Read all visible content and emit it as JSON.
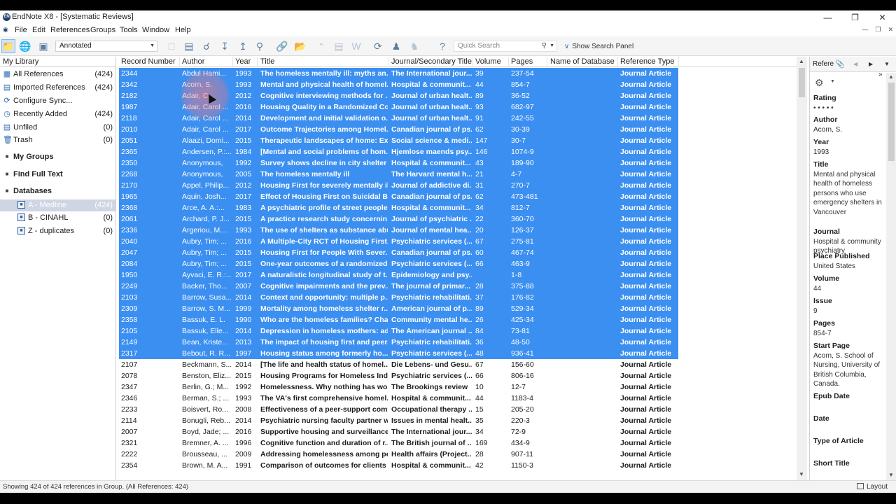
{
  "window": {
    "title": "EndNote X8 - [Systematic Reviews]",
    "app_icon_text": "EN"
  },
  "window_controls": [
    "minimize",
    "restore",
    "close"
  ],
  "menu": [
    "File",
    "Edit",
    "References",
    "Groups",
    "Tools",
    "Window",
    "Help"
  ],
  "toolbar": {
    "style": "Annotated",
    "quick_search_placeholder": "Quick Search",
    "show_search_panel": "Show Search Panel"
  },
  "library": {
    "header": "My Library",
    "groups": [
      {
        "label": "All References",
        "count": "(424)",
        "icon": "library-icon"
      },
      {
        "label": "Imported References",
        "count": "(424)",
        "icon": "import-icon"
      },
      {
        "label": "Configure Sync...",
        "count": "",
        "icon": "sync-icon"
      },
      {
        "label": "Recently Added",
        "count": "(424)",
        "icon": "clock-icon"
      },
      {
        "label": "Unfiled",
        "count": "(0)",
        "icon": "unfiled-icon"
      },
      {
        "label": "Trash",
        "count": "(0)",
        "icon": "trash-icon"
      }
    ],
    "sections": [
      "My Groups",
      "Find Full Text",
      "Databases"
    ],
    "databases": [
      {
        "label": "A - Medline",
        "count": "(424)"
      },
      {
        "label": "B - CINAHL",
        "count": "(0)"
      },
      {
        "label": "Z - duplicates",
        "count": "(0)"
      }
    ]
  },
  "columns": [
    "Record Number",
    "Author",
    "Year",
    "Title",
    "Journal/Secondary Title",
    "Volume",
    "Pages",
    "Name of Database",
    "Reference Type"
  ],
  "references": [
    {
      "rec": "2344",
      "author": "Abdul Hami...",
      "year": "1993",
      "title": "The homeless mentally ill: myths an...",
      "journal": "The International jour...",
      "vol": "39",
      "pages": "237-54",
      "db": "",
      "type": "Journal Article",
      "sel": true
    },
    {
      "rec": "2342",
      "author": "Acorn, S.",
      "year": "1993",
      "title": "Mental and physical health of homel...",
      "journal": "Hospital & communit...",
      "vol": "44",
      "pages": "854-7",
      "db": "",
      "type": "Journal Article",
      "sel": true
    },
    {
      "rec": "2182",
      "author": "Adair, C...",
      "year": "2012",
      "title": "Cognitive interviewing methods for ...",
      "journal": "Journal of urban healt...",
      "vol": "89",
      "pages": "36-52",
      "db": "",
      "type": "Journal Article",
      "sel": true
    },
    {
      "rec": "1987",
      "author": "Adair, Carol ...",
      "year": "2016",
      "title": "Housing Quality in a Randomized Co...",
      "journal": "Journal of urban healt...",
      "vol": "93",
      "pages": "682-97",
      "db": "",
      "type": "Journal Article",
      "sel": true
    },
    {
      "rec": "2118",
      "author": "Adair, Carol ...",
      "year": "2014",
      "title": "Development and initial validation o...",
      "journal": "Journal of urban healt...",
      "vol": "91",
      "pages": "242-55",
      "db": "",
      "type": "Journal Article",
      "sel": true
    },
    {
      "rec": "2010",
      "author": "Adair, Carol ...",
      "year": "2017",
      "title": "Outcome Trajectories among Homel...",
      "journal": "Canadian journal of ps...",
      "vol": "62",
      "pages": "30-39",
      "db": "",
      "type": "Journal Article",
      "sel": true
    },
    {
      "rec": "2051",
      "author": "Alaazi, Domi...",
      "year": "2015",
      "title": "Therapeutic landscapes of home: Ex...",
      "journal": "Social science & medi...",
      "vol": "147",
      "pages": "30-7",
      "db": "",
      "type": "Journal Article",
      "sel": true
    },
    {
      "rec": "2365",
      "author": "Andersen, P.:...",
      "year": "1984",
      "title": "[Mental and social problems of hom...",
      "journal": "Hjemlose maends psy...",
      "vol": "146",
      "pages": "1074-9",
      "db": "",
      "type": "Journal Article",
      "sel": true
    },
    {
      "rec": "2350",
      "author": "Anonymous,",
      "year": "1992",
      "title": "Survey shows decline in city shelter ...",
      "journal": "Hospital & communit...",
      "vol": "43",
      "pages": "189-90",
      "db": "",
      "type": "Journal Article",
      "sel": true
    },
    {
      "rec": "2268",
      "author": "Anonymous,",
      "year": "2005",
      "title": "The homeless mentally ill",
      "journal": "The Harvard mental h...",
      "vol": "21",
      "pages": "4-7",
      "db": "",
      "type": "Journal Article",
      "sel": true
    },
    {
      "rec": "2170",
      "author": "Appel, Philip...",
      "year": "2012",
      "title": "Housing First for severely mentally il...",
      "journal": "Journal of addictive di...",
      "vol": "31",
      "pages": "270-7",
      "db": "",
      "type": "Journal Article",
      "sel": true
    },
    {
      "rec": "1965",
      "author": "Aquin, Josh...",
      "year": "2017",
      "title": "Effect of Housing First on Suicidal B...",
      "journal": "Canadian journal of ps...",
      "vol": "62",
      "pages": "473-481",
      "db": "",
      "type": "Journal Article",
      "sel": true
    },
    {
      "rec": "2368",
      "author": "Arce, A. A.:...",
      "year": "1983",
      "title": "A psychiatric profile of street people...",
      "journal": "Hospital & communit...",
      "vol": "34",
      "pages": "812-7",
      "db": "",
      "type": "Journal Article",
      "sel": true
    },
    {
      "rec": "2061",
      "author": "Archard, P. J...",
      "year": "2015",
      "title": "A practice research study concernin...",
      "journal": "Journal of psychiatric ...",
      "vol": "22",
      "pages": "360-70",
      "db": "",
      "type": "Journal Article",
      "sel": true
    },
    {
      "rec": "2336",
      "author": "Argeriou, M....",
      "year": "1993",
      "title": "The use of shelters as substance abu...",
      "journal": "Journal of mental hea...",
      "vol": "20",
      "pages": "126-37",
      "db": "",
      "type": "Journal Article",
      "sel": true
    },
    {
      "rec": "2040",
      "author": "Aubry, Tim; ...",
      "year": "2016",
      "title": "A Multiple-City RCT of Housing First...",
      "journal": "Psychiatric services (...",
      "vol": "67",
      "pages": "275-81",
      "db": "",
      "type": "Journal Article",
      "sel": true
    },
    {
      "rec": "2047",
      "author": "Aubry, Tim; ...",
      "year": "2015",
      "title": "Housing First for People With Sever...",
      "journal": "Canadian journal of ps...",
      "vol": "60",
      "pages": "467-74",
      "db": "",
      "type": "Journal Article",
      "sel": true
    },
    {
      "rec": "2084",
      "author": "Aubry, Tim; ...",
      "year": "2015",
      "title": "One-year outcomes of a randomized...",
      "journal": "Psychiatric services (...",
      "vol": "66",
      "pages": "463-9",
      "db": "",
      "type": "Journal Article",
      "sel": true
    },
    {
      "rec": "1950",
      "author": "Ayvaci, E. R.:...",
      "year": "2017",
      "title": "A naturalistic longitudinal study of t...",
      "journal": "Epidemiology and psy...",
      "vol": "",
      "pages": "1-8",
      "db": "",
      "type": "Journal Article",
      "sel": true
    },
    {
      "rec": "2249",
      "author": "Backer, Tho...",
      "year": "2007",
      "title": "Cognitive impairments and the prev...",
      "journal": "The journal of primar...",
      "vol": "28",
      "pages": "375-88",
      "db": "",
      "type": "Journal Article",
      "sel": true
    },
    {
      "rec": "2103",
      "author": "Barrow, Susa...",
      "year": "2014",
      "title": "Context and opportunity: multiple p...",
      "journal": "Psychiatric rehabilitati...",
      "vol": "37",
      "pages": "176-82",
      "db": "",
      "type": "Journal Article",
      "sel": true
    },
    {
      "rec": "2309",
      "author": "Barrow, S. M...",
      "year": "1999",
      "title": "Mortality among homeless shelter r...",
      "journal": "American journal of p...",
      "vol": "89",
      "pages": "529-34",
      "db": "",
      "type": "Journal Article",
      "sel": true
    },
    {
      "rec": "2358",
      "author": "Bassuk, E. L.",
      "year": "1990",
      "title": "Who are the homeless families? Cha...",
      "journal": "Community mental he...",
      "vol": "26",
      "pages": "425-34",
      "db": "",
      "type": "Journal Article",
      "sel": true
    },
    {
      "rec": "2105",
      "author": "Bassuk, Elle...",
      "year": "2014",
      "title": "Depression in homeless mothers: ad...",
      "journal": "The American journal ...",
      "vol": "84",
      "pages": "73-81",
      "db": "",
      "type": "Journal Article",
      "sel": true
    },
    {
      "rec": "2149",
      "author": "Bean, Kriste...",
      "year": "2013",
      "title": "The impact of housing first and peer...",
      "journal": "Psychiatric rehabilitati...",
      "vol": "36",
      "pages": "48-50",
      "db": "",
      "type": "Journal Article",
      "sel": true
    },
    {
      "rec": "2317",
      "author": "Bebout, R. R...",
      "year": "1997",
      "title": "Housing status among formerly ho...",
      "journal": "Psychiatric services (...",
      "vol": "48",
      "pages": "936-41",
      "db": "",
      "type": "Journal Article",
      "sel": true
    },
    {
      "rec": "2107",
      "author": "Beckmann, S...",
      "year": "2014",
      "title": "[The life and health status of homel...",
      "journal": "Die Lebens- und Gesu...",
      "vol": "67",
      "pages": "156-60",
      "db": "",
      "type": "Journal Article",
      "sel": false
    },
    {
      "rec": "2078",
      "author": "Benston, Eliz...",
      "year": "2015",
      "title": "Housing Programs for Homeless Ind...",
      "journal": "Psychiatric services (...",
      "vol": "66",
      "pages": "806-16",
      "db": "",
      "type": "Journal Article",
      "sel": false
    },
    {
      "rec": "2347",
      "author": "Berlin, G.; M...",
      "year": "1992",
      "title": "Homelessness. Why nothing has wo...",
      "journal": "The Brookings review",
      "vol": "10",
      "pages": "12-7",
      "db": "",
      "type": "Journal Article",
      "sel": false
    },
    {
      "rec": "2346",
      "author": "Berman, S.; ...",
      "year": "1993",
      "title": "The VA's first comprehensive homel...",
      "journal": "Hospital & communit...",
      "vol": "44",
      "pages": "1183-4",
      "db": "",
      "type": "Journal Article",
      "sel": false
    },
    {
      "rec": "2233",
      "author": "Boisvert, Ro...",
      "year": "2008",
      "title": "Effectiveness of a peer-support com...",
      "journal": "Occupational therapy ...",
      "vol": "15",
      "pages": "205-20",
      "db": "",
      "type": "Journal Article",
      "sel": false
    },
    {
      "rec": "2114",
      "author": "Bonugli, Reb...",
      "year": "2014",
      "title": "Psychiatric nursing faculty partner w...",
      "journal": "Issues in mental healt...",
      "vol": "35",
      "pages": "220-3",
      "db": "",
      "type": "Journal Article",
      "sel": false
    },
    {
      "rec": "2007",
      "author": "Boyd, Jade; ...",
      "year": "2016",
      "title": "Supportive housing and surveillance",
      "journal": "The International jour...",
      "vol": "34",
      "pages": "72-9",
      "db": "",
      "type": "Journal Article",
      "sel": false
    },
    {
      "rec": "2321",
      "author": "Bremner, A. ...",
      "year": "1996",
      "title": "Cognitive function and duration of r...",
      "journal": "The British journal of ...",
      "vol": "169",
      "pages": "434-9",
      "db": "",
      "type": "Journal Article",
      "sel": false
    },
    {
      "rec": "2222",
      "author": "Brousseau, ...",
      "year": "2009",
      "title": "Addressing homelessness among pe...",
      "journal": "Health affairs (Project...",
      "vol": "28",
      "pages": "907-11",
      "db": "",
      "type": "Journal Article",
      "sel": false
    },
    {
      "rec": "2354",
      "author": "Brown, M. A...",
      "year": "1991",
      "title": "Comparison of outcomes for clients ...",
      "journal": "Hospital & communit...",
      "vol": "42",
      "pages": "1150-3",
      "db": "",
      "type": "Journal Article",
      "sel": false
    }
  ],
  "detail": {
    "tab": "Refere",
    "fields": [
      {
        "label": "Rating",
        "value": "• • • • •"
      },
      {
        "label": "Author",
        "value": "Acorn, S."
      },
      {
        "label": "Year",
        "value": "1993"
      },
      {
        "label": "Title",
        "value": "Mental and physical health of homeless persons who use emergency shelters in Vancouver"
      },
      {
        "label": "Journal",
        "value": "Hospital & community psychiatry"
      },
      {
        "label": "Place Published",
        "value": "United States"
      },
      {
        "label": "Volume",
        "value": "44"
      },
      {
        "label": "Issue",
        "value": "9"
      },
      {
        "label": "Pages",
        "value": "854-7"
      },
      {
        "label": "Start Page",
        "value": "Acorn, S. School of Nursing, University of British Columbia, Canada."
      },
      {
        "label": "Epub Date",
        "value": ""
      },
      {
        "label": "Date",
        "value": ""
      },
      {
        "label": "Type of Article",
        "value": ""
      },
      {
        "label": "Short Title",
        "value": ""
      }
    ]
  },
  "status": {
    "text": "Showing 424 of 424 references in Group. (All References: 424)",
    "layout": "Layout"
  }
}
